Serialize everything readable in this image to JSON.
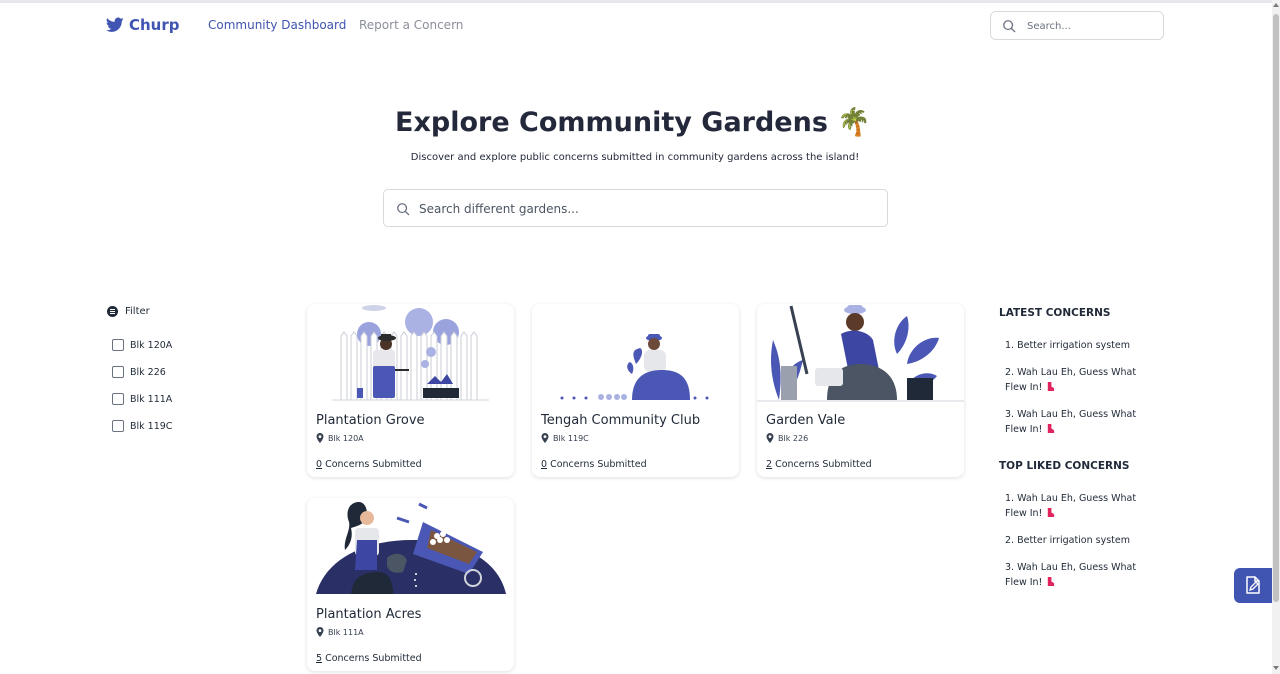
{
  "brand": {
    "name": "Churp",
    "icon": "bird-icon"
  },
  "nav": {
    "links": [
      {
        "label": "Community Dashboard",
        "active": true
      },
      {
        "label": "Report a Concern",
        "active": false
      }
    ],
    "search": {
      "placeholder": "Search..."
    }
  },
  "hero": {
    "title": "Explore Community Gardens",
    "emoji": "🌴",
    "subtitle": "Discover and explore public concerns submitted in community gardens across the island!",
    "search_placeholder": "Search different gardens..."
  },
  "filter": {
    "label": "Filter",
    "options": [
      "Blk 120A",
      "Blk 226",
      "Blk 111A",
      "Blk 119C"
    ]
  },
  "gardens": [
    {
      "name": "Plantation Grove",
      "location": "Blk 120A",
      "count": "0",
      "count_label": "Concerns Submitted"
    },
    {
      "name": "Tengah Community Club",
      "location": "Blk 119C",
      "count": "0",
      "count_label": "Concerns Submitted"
    },
    {
      "name": "Garden Vale",
      "location": "Blk 226",
      "count": "2",
      "count_label": "Concerns Submitted"
    },
    {
      "name": "Plantation Acres",
      "location": "Blk 111A",
      "count": "5",
      "count_label": "Concerns Submitted"
    }
  ],
  "latest": {
    "heading": "LATEST CONCERNS",
    "items": [
      "1. Better irrigation system",
      "2. Wah Lau Eh, Guess What Flew In!",
      "3. Wah Lau Eh, Guess What Flew In!"
    ]
  },
  "top_liked": {
    "heading": "TOP LIKED CONCERNS",
    "items": [
      "1. Wah Lau Eh, Guess What Flew In!",
      "2. Better irrigation system",
      "3. Wah Lau Eh, Guess What Flew In!"
    ]
  },
  "colors": {
    "accent": "#4054b2",
    "illustration": "#4a57b5",
    "boot": "#e0245e"
  }
}
